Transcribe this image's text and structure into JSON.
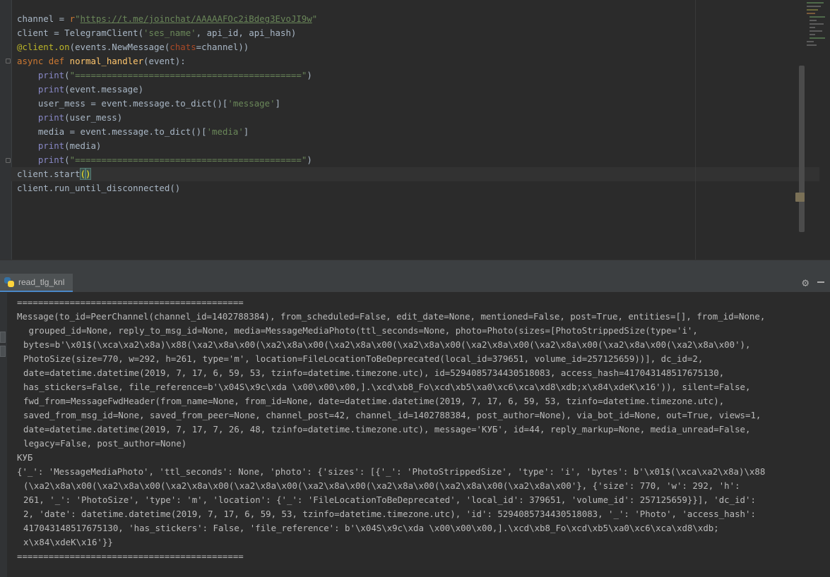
{
  "editor": {
    "lines": [
      "channel = r\"https://t.me/joinchat/AAAAAFOc2iBdeg3EvoJI9w\"",
      "client = TelegramClient('ses_name', api_id, api_hash)",
      "@client.on(events.NewMessage(chats=channel))",
      "async def normal_handler(event):",
      "    print(\"===========================================\")",
      "    print(event.message)",
      "    user_mess = event.message.to_dict()['message']",
      "    print(user_mess)",
      "    media = event.message.to_dict()['media']",
      "    print(media)",
      "    print(\"===========================================\")",
      "client.start()",
      "client.run_until_disconnected()"
    ],
    "url": "https://t.me/joinchat/AAAAAFOc2iBdeg3EvoJI9w",
    "separator_string": "\"===========================================\""
  },
  "run_panel": {
    "tab_label": "read_tlg_knl",
    "tab_icon": "python-icon",
    "settings_icon": "gear-icon",
    "minimize_icon": "minimize-icon"
  },
  "console": {
    "lines": [
      "===========================================",
      "Message(to_id=PeerChannel(channel_id=1402788384), from_scheduled=False, edit_date=None, mentioned=False, post=True, entities=[], from_id=None,",
      " grouped_id=None, reply_to_msg_id=None, media=MessageMediaPhoto(ttl_seconds=None, photo=Photo(sizes=[PhotoStrippedSize(type='i',",
      "bytes=b'\\x01$(\\xca\\xa2\\x8a)\\x88(\\xa2\\x8a\\x00(\\xa2\\x8a\\x00(\\xa2\\x8a\\x00(\\xa2\\x8a\\x00(\\xa2\\x8a\\x00(\\xa2\\x8a\\x00(\\xa2\\x8a\\x00(\\xa2\\x8a\\x00'),",
      "PhotoSize(size=770, w=292, h=261, type='m', location=FileLocationToBeDeprecated(local_id=379651, volume_id=257125659))], dc_id=2,",
      "date=datetime.datetime(2019, 7, 17, 6, 59, 53, tzinfo=datetime.timezone.utc), id=5294085734430518083, access_hash=417043148517675130,",
      "has_stickers=False, file_reference=b'\\x04S\\x9c\\xda \\x00\\x00\\x00,].\\xcd\\xb8_Fo\\xcd\\xb5\\xa0\\xc6\\xca\\xd8\\xdb;x\\x84\\xdeK\\x16')), silent=False,",
      "fwd_from=MessageFwdHeader(from_name=None, from_id=None, date=datetime.datetime(2019, 7, 17, 6, 59, 53, tzinfo=datetime.timezone.utc),",
      "saved_from_msg_id=None, saved_from_peer=None, channel_post=42, channel_id=1402788384, post_author=None), via_bot_id=None, out=True, views=1,",
      "date=datetime.datetime(2019, 7, 17, 7, 26, 48, tzinfo=datetime.timezone.utc), message='КУБ', id=44, reply_markup=None, media_unread=False,",
      "legacy=False, post_author=None)",
      "КУБ",
      "{'_': 'MessageMediaPhoto', 'ttl_seconds': None, 'photo': {'sizes': [{'_': 'PhotoStrippedSize', 'type': 'i', 'bytes': b'\\x01$(\\xca\\xa2\\x8a)\\x88",
      "(\\xa2\\x8a\\x00(\\xa2\\x8a\\x00(\\xa2\\x8a\\x00(\\xa2\\x8a\\x00(\\xa2\\x8a\\x00(\\xa2\\x8a\\x00(\\xa2\\x8a\\x00(\\xa2\\x8a\\x00'}, {'size': 770, 'w': 292, 'h':",
      "261, '_': 'PhotoSize', 'type': 'm', 'location': {'_': 'FileLocationToBeDeprecated', 'local_id': 379651, 'volume_id': 257125659}}], 'dc_id':",
      "2, 'date': datetime.datetime(2019, 7, 17, 6, 59, 53, tzinfo=datetime.timezone.utc), 'id': 5294085734430518083, '_': 'Photo', 'access_hash':",
      "417043148517675130, 'has_stickers': False, 'file_reference': b'\\x04S\\x9c\\xda \\x00\\x00\\x00,].\\xcd\\xb8_Fo\\xcd\\xb5\\xa0\\xc6\\xca\\xd8\\xdb;",
      "x\\x84\\xdeK\\x16'}}",
      "==========================================="
    ]
  },
  "colors": {
    "background": "#2b2b2b",
    "keyword": "#cc7832",
    "string": "#6a8759",
    "function": "#ffc66d",
    "decorator": "#bbb529",
    "builtin": "#8888c6",
    "text": "#a9b7c6",
    "console_text": "#bbbbbb"
  }
}
